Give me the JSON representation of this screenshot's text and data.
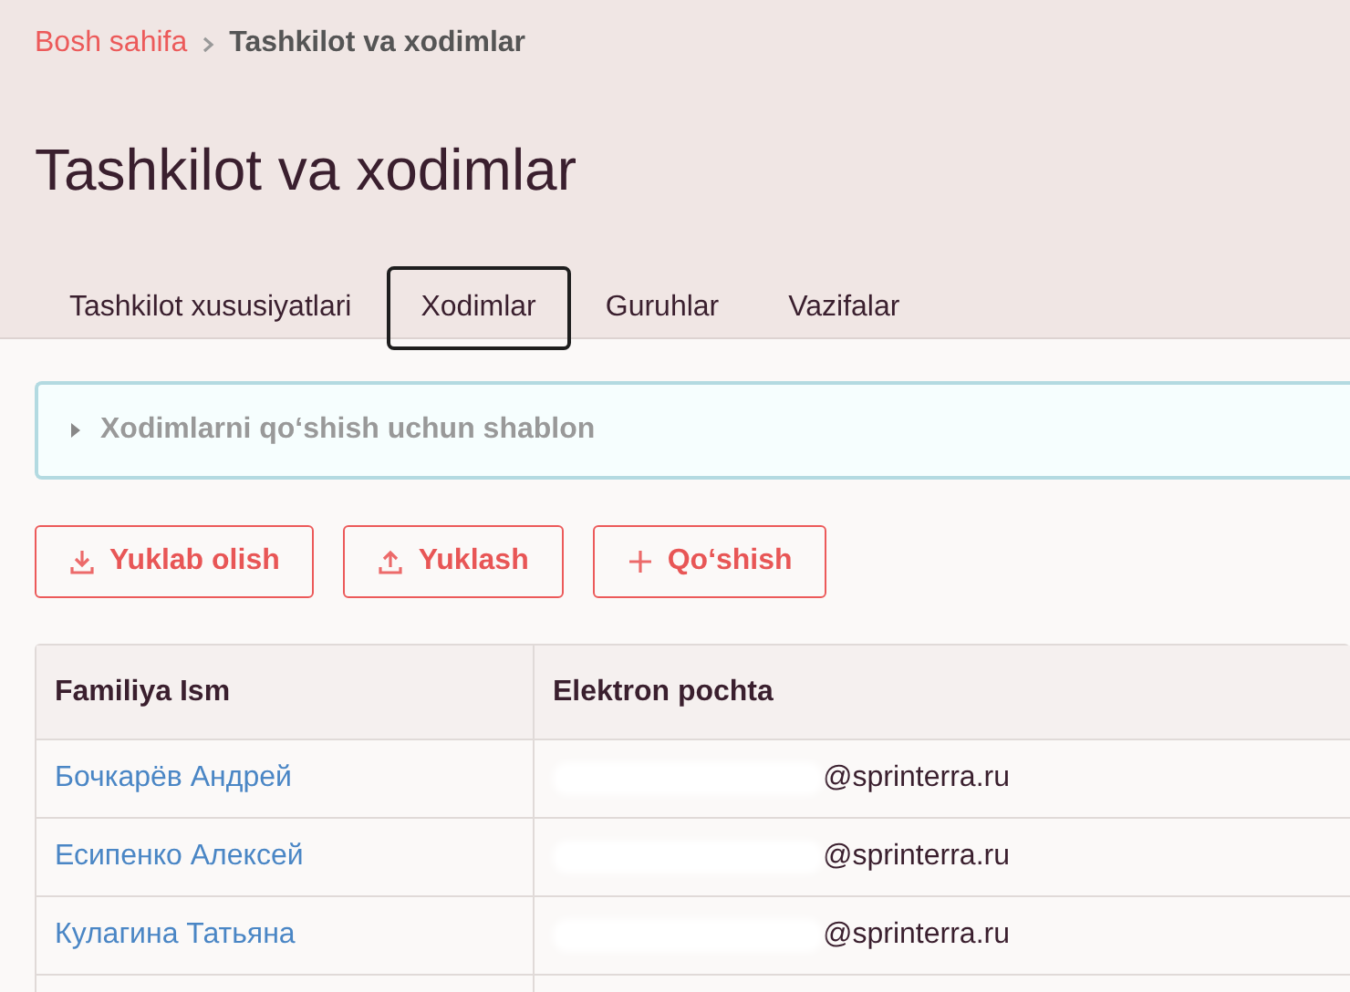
{
  "breadcrumb": [
    {
      "label": "Bosh sahifa",
      "current": false
    },
    {
      "label": "Tashkilot va xodimlar",
      "current": true
    }
  ],
  "page_title": "Tashkilot va xodimlar",
  "tabs": [
    {
      "label": "Tashkilot xususiyatlari",
      "selected": false
    },
    {
      "label": "Xodimlar",
      "selected": true
    },
    {
      "label": "Guruhlar",
      "selected": false
    },
    {
      "label": "Vazifalar",
      "selected": false
    }
  ],
  "template_panel": {
    "title": "Xodimlarni qo‘shish uchun shablon",
    "expanded": false
  },
  "buttons": [
    {
      "label": "Yuklab olish",
      "kind": "download"
    },
    {
      "label": "Yuklash",
      "kind": "upload"
    },
    {
      "label": "Qo‘shish",
      "kind": "add"
    }
  ],
  "table": {
    "columns": [
      "Familiya Ism",
      "Elektron pochta"
    ],
    "rows": [
      {
        "name": "Бочкарёв Андрей",
        "email": "@sprinterra.ru"
      },
      {
        "name": "Есипенко Алексей",
        "email": "@sprinterra.ru"
      },
      {
        "name": "Кулагина Татьяна",
        "email": "@sprinterra.ru"
      }
    ]
  }
}
